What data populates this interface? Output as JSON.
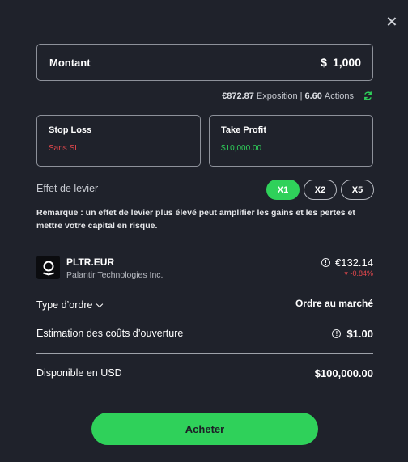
{
  "close": {
    "icon": "close-icon"
  },
  "amount": {
    "label": "Montant",
    "currency": "$",
    "value": "1,000"
  },
  "exposure": {
    "amount": "€872.87",
    "amount_label": "Exposition",
    "separator": "|",
    "shares": "6.60",
    "shares_label": "Actions",
    "icon": "refresh-icon"
  },
  "stop_loss": {
    "title": "Stop Loss",
    "value": "Sans SL",
    "color": "#e5484d"
  },
  "take_profit": {
    "title": "Take Profit",
    "value": "$10,000.00",
    "color": "#2fd15a"
  },
  "leverage": {
    "label": "Effet de levier",
    "options": [
      "X1",
      "X2",
      "X5"
    ],
    "selected": "X1"
  },
  "remark": "Remarque : un effet de levier plus élevé peut amplifier les gains et les pertes et mettre votre capital en risque.",
  "stock": {
    "ticker": "PLTR.EUR",
    "name": "Palantir Technologies Inc.",
    "price": "€132.14",
    "change": "-0.84%",
    "logo_icon": "palantir-logo"
  },
  "order": {
    "label": "Type d’ordre",
    "value": "Ordre au marché"
  },
  "cost": {
    "label": "Estimation des coûts d’ouverture",
    "value": "$1.00"
  },
  "available": {
    "label": "Disponible en USD",
    "value": "$100,000.00"
  },
  "buy_button": "Acheter",
  "colors": {
    "accent": "#2fd15a",
    "negative": "#e5484d",
    "background": "#1f222b"
  }
}
